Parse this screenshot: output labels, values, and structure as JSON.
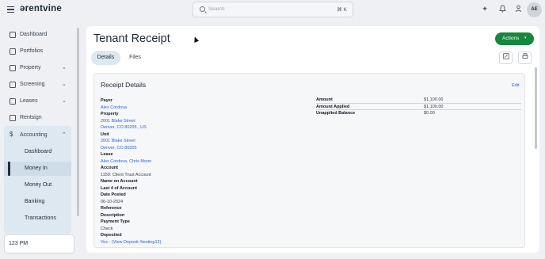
{
  "app": {
    "logo": "ərentvine"
  },
  "topbar": {
    "search_placeholder": "Search",
    "search_shortcut": "⌘ K",
    "avatar_initials": "AE",
    "icons": [
      "sparkle-icon",
      "bell-icon",
      "person-icon"
    ]
  },
  "sidebar": {
    "items": [
      {
        "label": "Dashboard",
        "icon": "grid-icon"
      },
      {
        "label": "Portfolios",
        "icon": "folder-icon"
      },
      {
        "label": "Property",
        "icon": "building-icon",
        "expandable": true
      },
      {
        "label": "Screening",
        "icon": "screening-icon",
        "expandable": true
      },
      {
        "label": "Leases",
        "icon": "lease-icon",
        "expandable": true
      },
      {
        "label": "Rentsign",
        "icon": "sign-icon"
      },
      {
        "label": "Accounting",
        "icon": "dollar-icon",
        "expanded": true
      }
    ],
    "accounting_sub": [
      {
        "label": "Dashboard"
      },
      {
        "label": "Money In",
        "active": true
      },
      {
        "label": "Money Out"
      },
      {
        "label": "Banking"
      },
      {
        "label": "Transactions"
      }
    ],
    "time": "123 PM"
  },
  "page": {
    "title": "Tenant Receipt",
    "actions_label": "Actions",
    "tabs": [
      {
        "label": "Details",
        "active": true
      },
      {
        "label": "Files"
      }
    ]
  },
  "receipt": {
    "title": "Receipt Details",
    "edit_label": "Edit",
    "fields": {
      "payer_label": "Payer",
      "payer": "Alex Cordova",
      "property_label": "Property",
      "property_line1": "2001 Blake Street",
      "property_line2": "Denver, CO 80205 , US",
      "unit_label": "Unit",
      "unit_line1": "2001 Blake Street",
      "unit_line2": "Denver, CO 80205",
      "lease_label": "Lease",
      "lease": "Alex Cordova, Chris Moon",
      "account_label": "Account",
      "account": "1150: Client Trust Account",
      "name_on_account_label": "Name on Account",
      "last4_label": "Last 4 of Account",
      "date_posted_label": "Date Posted",
      "date_posted": "06-10-2024",
      "reference_label": "Reference",
      "description_label": "Description",
      "payment_type_label": "Payment Type",
      "payment_type": "Check",
      "deposited_label": "Deposited",
      "deposited": "Yes - (View Deposit #testing12)"
    },
    "amounts": [
      {
        "label": "Amount",
        "value": "$1,100.00"
      },
      {
        "label": "Amount Applied",
        "value": "$1,100.00"
      },
      {
        "label": "Unapplied Balance",
        "value": "$0.00"
      }
    ]
  },
  "colors": {
    "primary": "#16873e",
    "link": "#2563eb",
    "nav_active": "#dde8f1"
  }
}
